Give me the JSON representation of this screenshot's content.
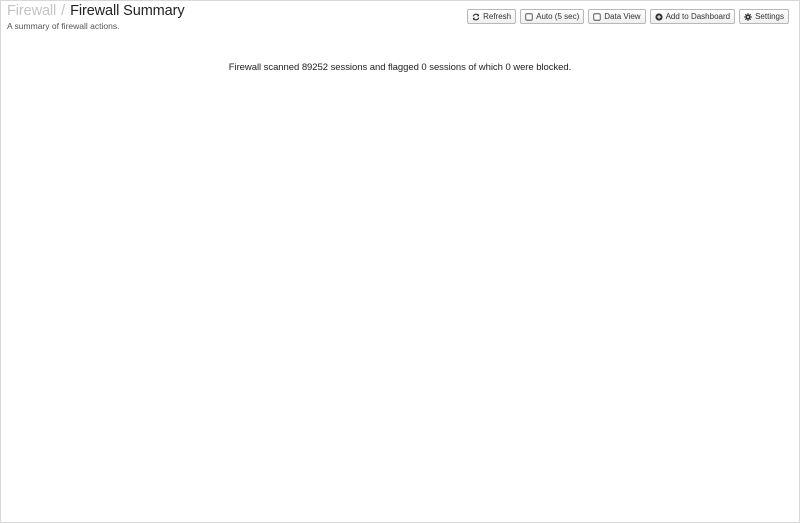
{
  "breadcrumb": {
    "parent": "Firewall",
    "separator": "/",
    "current": "Firewall Summary"
  },
  "subtitle": "A summary of firewall actions.",
  "toolbar": {
    "refresh_label": "Refresh",
    "auto_label": "Auto (5 sec)",
    "data_view_label": "Data View",
    "add_dashboard_label": "Add to Dashboard",
    "settings_label": "Settings"
  },
  "summary": {
    "text": "Firewall scanned 89252 sessions and flagged 0 sessions of which 0 were blocked."
  },
  "colors": {
    "breadcrumb_parent": "#c4c4c4",
    "title": "#222222",
    "border": "#d8d8d8"
  }
}
